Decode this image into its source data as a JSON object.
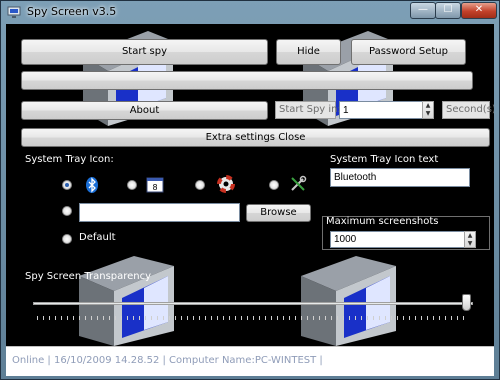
{
  "window": {
    "title": "Spy Screen v3.5",
    "controls": {
      "minimize": "—",
      "maximize": "☐",
      "close": "✕"
    }
  },
  "toolbar": {
    "start_spy": "Start spy",
    "hide": "Hide",
    "password_setup": "Password Setup",
    "about": "About",
    "extra_settings": "Extra settings Close"
  },
  "start_in": {
    "label": "Start Spy in:",
    "value": "1",
    "unit": "Second(s)"
  },
  "tray": {
    "section_label": "System Tray Icon:",
    "text_label": "System Tray Icon text",
    "text_value": "Bluetooth",
    "icons": [
      "bluetooth-icon",
      "keyboard-icon",
      "lifebuoy-icon",
      "tools-icon"
    ],
    "selected": "bluetooth-icon",
    "custom_path": "",
    "browse": "Browse",
    "default": "Default"
  },
  "screenshots": {
    "label": "Maximum screenshots",
    "value": "1000"
  },
  "transparency": {
    "label": "Spy Screen Transparency",
    "level": 1.0
  },
  "status": {
    "text": "Online |  16/10/2009 14.28.52 |  Computer Name:PC-WINTEST |"
  },
  "colors": {
    "client_bg": "#000000",
    "accent": "#2a5fb0",
    "status_text": "#8f9cb8"
  }
}
